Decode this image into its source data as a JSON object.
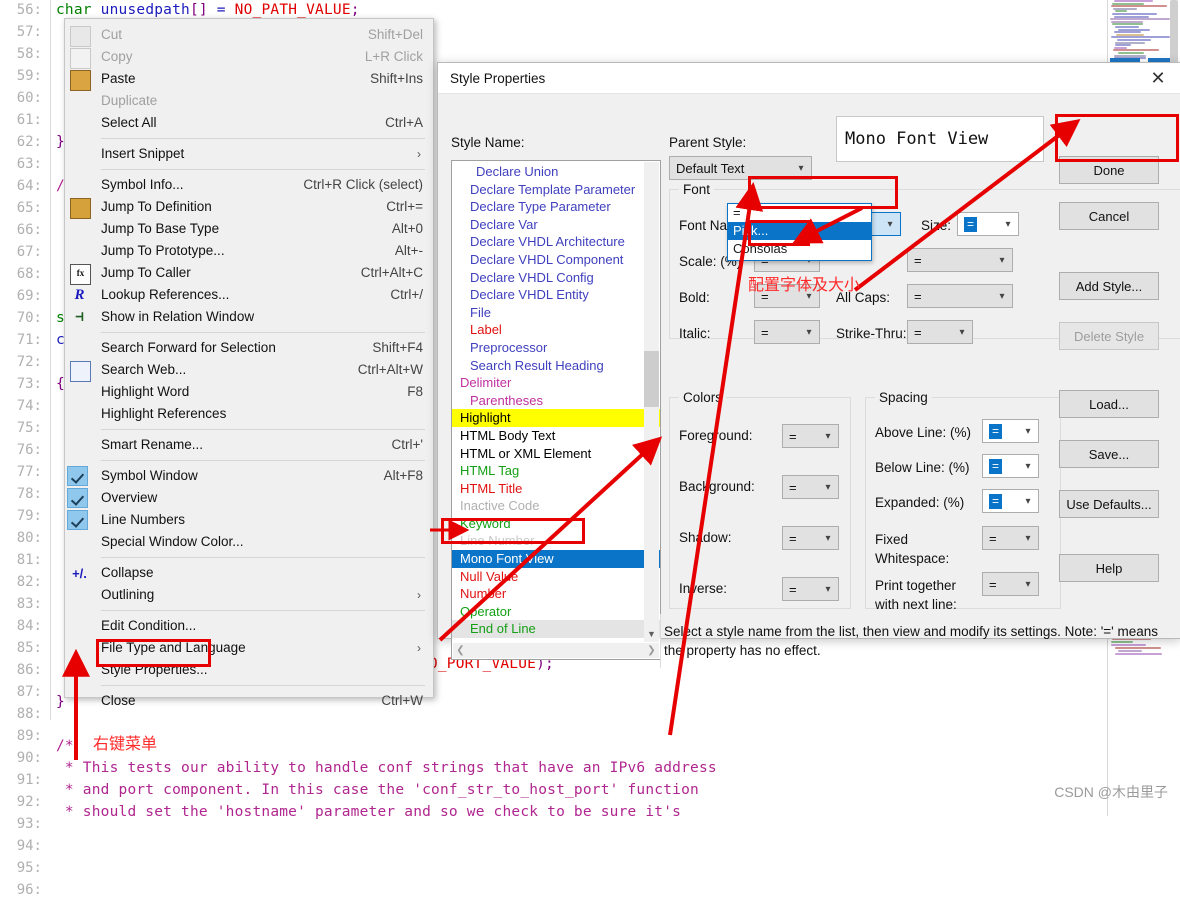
{
  "editor": {
    "first_line_code": "char unusedpath[] = NO_PATH_VALUE;",
    "gutter_start": 56,
    "gutter_end": 96,
    "lines": [
      {
        "n": 56,
        "text": ""
      },
      {
        "n": 66,
        "text": "}"
      },
      {
        "n": 68,
        "text": "/*"
      },
      {
        "n": 69,
        "text": " *"
      },
      {
        "n": 70,
        "text": " *"
      },
      {
        "n": 71,
        "text": " *"
      },
      {
        "n": 72,
        "text": " *"
      },
      {
        "n": 73,
        "text": " */"
      },
      {
        "n": 74,
        "text": "sta"
      },
      {
        "n": 75,
        "text": "con"
      },
      {
        "n": 76,
        "text": "{"
      },
      {
        "n": 91,
        "text": "}"
      },
      {
        "n": 93,
        "text": "/*"
      },
      {
        "n": 94,
        "text": " * This tests our ability to handle conf strings that have an IPv6 address"
      },
      {
        "n": 95,
        "text": " * and port component. In this case the 'conf_str_to_host_port' function"
      },
      {
        "n": 96,
        "text": " * should set the 'hostname' parameter and so we check to be sure it's"
      }
    ],
    "partial_code_fragment": "NO_PORT_VALUE);"
  },
  "context_menu": {
    "items": [
      {
        "label": "Cut",
        "accel": "Shift+Del",
        "icon": "cut-icon",
        "disabled": true
      },
      {
        "label": "Copy",
        "accel": "L+R Click",
        "icon": "copy-icon",
        "disabled": true
      },
      {
        "label": "Paste",
        "accel": "Shift+Ins",
        "icon": "paste-icon",
        "disabled": false
      },
      {
        "label": "Duplicate",
        "accel": "",
        "icon": "",
        "disabled": true
      },
      {
        "label": "Select All",
        "accel": "Ctrl+A",
        "icon": "",
        "disabled": false
      },
      {
        "separator": true
      },
      {
        "label": "Insert Snippet",
        "accel": "",
        "icon": "",
        "submenu": true,
        "disabled": false
      },
      {
        "separator": true
      },
      {
        "label": "Symbol Info...",
        "accel": "Ctrl+R Click (select)",
        "icon": "",
        "disabled": false
      },
      {
        "label": "Jump To Definition",
        "accel": "Ctrl+=",
        "icon": "jump-definition-icon",
        "disabled": false
      },
      {
        "label": "Jump To Base Type",
        "accel": "Alt+0",
        "icon": "",
        "disabled": false
      },
      {
        "label": "Jump To Prototype...",
        "accel": "Alt+-",
        "icon": "",
        "disabled": false
      },
      {
        "label": "Jump To Caller",
        "accel": "Ctrl+Alt+C",
        "icon": "function-caller-icon",
        "disabled": false
      },
      {
        "label": "Lookup References...",
        "accel": "Ctrl+/",
        "icon": "references-icon",
        "disabled": false
      },
      {
        "label": "Show in Relation Window",
        "accel": "",
        "icon": "relation-window-icon",
        "disabled": false
      },
      {
        "separator": true
      },
      {
        "label": "Search Forward for Selection",
        "accel": "Shift+F4",
        "icon": "",
        "disabled": false
      },
      {
        "label": "Search Web...",
        "accel": "Ctrl+Alt+W",
        "icon": "search-web-icon",
        "disabled": false
      },
      {
        "label": "Highlight Word",
        "accel": "F8",
        "icon": "",
        "disabled": false
      },
      {
        "label": "Highlight References",
        "accel": "",
        "icon": "",
        "disabled": false
      },
      {
        "separator": true
      },
      {
        "label": "Smart Rename...",
        "accel": "Ctrl+'",
        "icon": "",
        "disabled": false
      },
      {
        "separator": true
      },
      {
        "label": "Symbol Window",
        "accel": "Alt+F8",
        "icon": "check-icon",
        "checked": true,
        "disabled": false
      },
      {
        "label": "Overview",
        "accel": "",
        "icon": "check-icon",
        "checked": true,
        "disabled": false
      },
      {
        "label": "Line Numbers",
        "accel": "",
        "icon": "check-icon",
        "checked": true,
        "disabled": false
      },
      {
        "label": "Special Window Color...",
        "accel": "",
        "icon": "",
        "disabled": false
      },
      {
        "separator": true
      },
      {
        "label": "Collapse",
        "accel": "",
        "icon": "plus-minus-icon",
        "disabled": false
      },
      {
        "label": "Outlining",
        "accel": "",
        "icon": "",
        "submenu": true,
        "disabled": false
      },
      {
        "separator": true
      },
      {
        "label": "Edit Condition...",
        "accel": "",
        "icon": "",
        "disabled": false
      },
      {
        "label": "File Type and Language",
        "accel": "",
        "icon": "",
        "submenu": true,
        "disabled": false
      },
      {
        "label": "Style Properties...",
        "accel": "",
        "icon": "",
        "disabled": false,
        "highlighted": true
      },
      {
        "separator": true
      },
      {
        "label": "Close",
        "accel": "Ctrl+W",
        "icon": "",
        "disabled": false
      }
    ]
  },
  "dialog": {
    "title": "Style Properties",
    "close_label": "✕",
    "style_name_label": "Style Name:",
    "parent_style_label": "Parent Style:",
    "parent_style_value": "Default Text",
    "preview_text": "Mono Font View",
    "style_list": [
      {
        "label": "Declare Union",
        "color": "#3f3fbf",
        "indent": 2
      },
      {
        "label": "Declare Template Parameter",
        "color": "#3f3fbf",
        "indent": 1
      },
      {
        "label": "Declare Type Parameter",
        "color": "#3f3fbf",
        "indent": 1
      },
      {
        "label": "Declare Var",
        "color": "#3f3fbf",
        "indent": 1
      },
      {
        "label": "Declare VHDL Architecture",
        "color": "#3f3fbf",
        "indent": 1
      },
      {
        "label": "Declare VHDL Component",
        "color": "#3f3fbf",
        "indent": 1
      },
      {
        "label": "Declare VHDL Config",
        "color": "#3f3fbf",
        "indent": 1
      },
      {
        "label": "Declare VHDL Entity",
        "color": "#3f3fbf",
        "indent": 1
      },
      {
        "label": "File",
        "color": "#3f3fbf",
        "indent": 1
      },
      {
        "label": "Label",
        "color": "#e21212",
        "indent": 1
      },
      {
        "label": "Preprocessor",
        "color": "#3f3fbf",
        "indent": 1
      },
      {
        "label": "Search Result Heading",
        "color": "#3f3fbf",
        "indent": 1
      },
      {
        "label": "Delimiter",
        "color": "#c030a0",
        "indent": 0
      },
      {
        "label": "Parentheses",
        "color": "#c030a0",
        "indent": 1
      },
      {
        "label": "Highlight",
        "color": "#000000",
        "indent": 0,
        "background": "#ffff00"
      },
      {
        "label": "HTML Body Text",
        "color": "#000000",
        "indent": 0
      },
      {
        "label": "HTML or XML Element",
        "color": "#000000",
        "indent": 0
      },
      {
        "label": "HTML Tag",
        "color": "#14a014",
        "indent": 0
      },
      {
        "label": "HTML Title",
        "color": "#e21212",
        "indent": 0
      },
      {
        "label": "Inactive Code",
        "color": "#b0b0b0",
        "indent": 0
      },
      {
        "label": "Keyword",
        "color": "#14a014",
        "indent": 0
      },
      {
        "label": "Line Number",
        "color": "#c8c8c8",
        "indent": 0
      },
      {
        "label": "Mono Font View",
        "color": "#ffffff",
        "indent": 0,
        "selected": true
      },
      {
        "label": "Null Value",
        "color": "#e21212",
        "indent": 0
      },
      {
        "label": "Number",
        "color": "#e21212",
        "indent": 0
      },
      {
        "label": "Operator",
        "color": "#14a014",
        "indent": 0
      },
      {
        "label": "End of Line",
        "color": "#14a014",
        "indent": 1,
        "background": "#e4e4e4"
      }
    ],
    "font_group": {
      "title": "Font",
      "font_name_label": "Font Name:",
      "font_name_value": "Consolas",
      "size_label": "Size:",
      "size_value": "=",
      "scale_label": "Scale: (%)",
      "scale_value": "=",
      "bold_label": "Bold:",
      "bold_value": "=",
      "all_caps_label": "All Caps:",
      "all_caps_value": "=",
      "italic_label": "Italic:",
      "italic_value": "=",
      "strike_label": "Strike-Thru:",
      "strike_value": "=",
      "underline_value": "=",
      "dropdown_options": [
        "=",
        "Pick...",
        "Consolas"
      ],
      "dropdown_selected": "Pick..."
    },
    "colors_group": {
      "title": "Colors",
      "rows": [
        {
          "label": "Foreground:",
          "value": "="
        },
        {
          "label": "Background:",
          "value": "="
        },
        {
          "label": "Shadow:",
          "value": "="
        },
        {
          "label": "Inverse:",
          "value": "="
        }
      ]
    },
    "spacing_group": {
      "title": "Spacing",
      "rows": [
        {
          "label": "Above Line: (%)",
          "value": "=",
          "blue": true
        },
        {
          "label": "Below Line: (%)",
          "value": "=",
          "blue": true
        },
        {
          "label": "Expanded: (%)",
          "value": "=",
          "blue": true
        },
        {
          "label": "Fixed\nWhitespace:",
          "value": "=",
          "blue": false
        },
        {
          "label": "Print together\nwith next line:",
          "value": "=",
          "blue": false
        }
      ]
    },
    "buttons": [
      {
        "label": "Done",
        "disabled": false,
        "highlighted": true
      },
      {
        "label": "Cancel",
        "disabled": false
      },
      {
        "label": "Add Style...",
        "disabled": false
      },
      {
        "label": "Delete Style",
        "disabled": true
      },
      {
        "label": "Load...",
        "disabled": false
      },
      {
        "label": "Save...",
        "disabled": false
      },
      {
        "label": "Use Defaults...",
        "disabled": false
      },
      {
        "label": "Help",
        "disabled": false
      }
    ],
    "hint_text": "Select a style name from the list, then view and modify its settings. Note: '=' means the property has no effect."
  },
  "annotations": {
    "right_click_menu_note": "右键菜单",
    "font_size_note": "配置字体及大小",
    "accent_color": "#e60000"
  },
  "watermark": "CSDN @木由里子"
}
